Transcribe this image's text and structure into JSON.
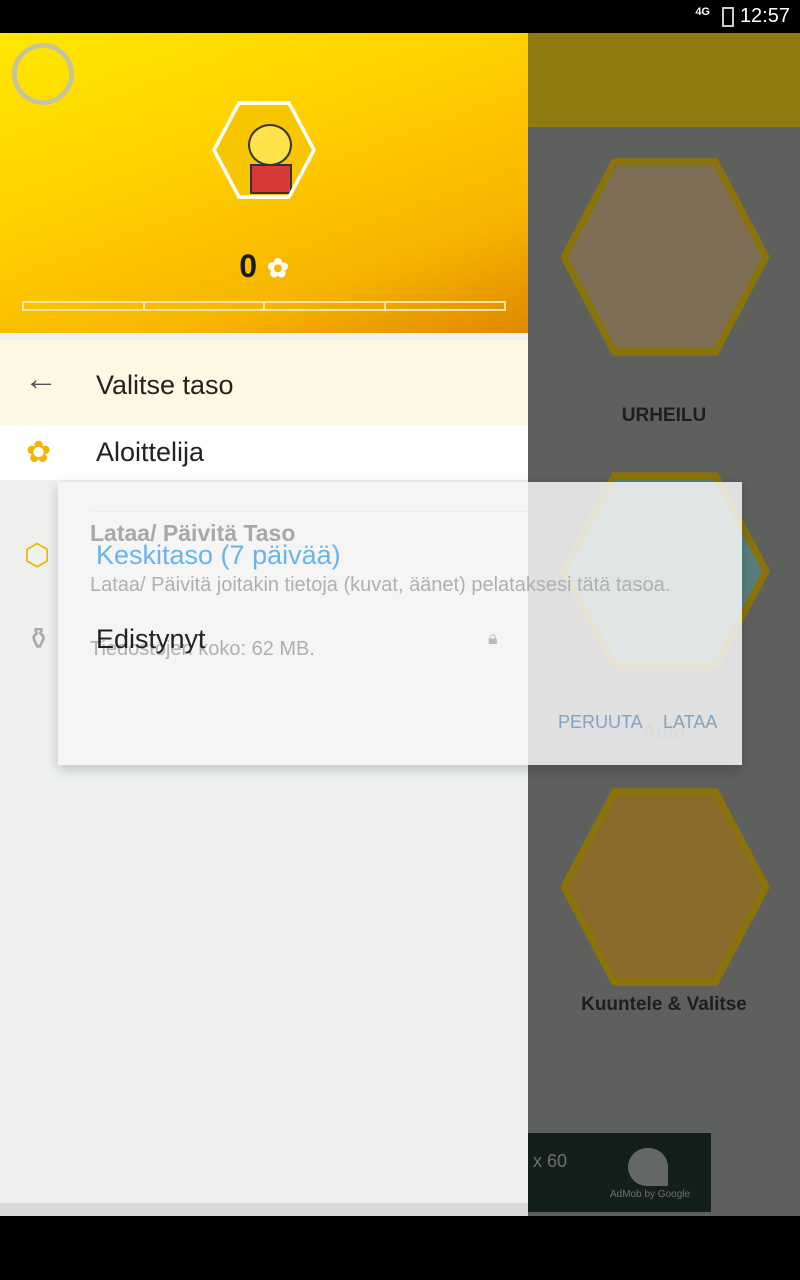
{
  "status_bar": {
    "network": "4G",
    "time": "12:57"
  },
  "background_app": {
    "tiles": [
      {
        "label": "URHEILU",
        "icon": "volleyball-icon"
      },
      {
        "label": "Auto",
        "icon": "car-icon"
      },
      {
        "label": "Kuuntele & Valitse",
        "icon": "categories-icon"
      }
    ],
    "ad": {
      "size_text": "x 60",
      "brand": "AdMob by Google"
    }
  },
  "drawer": {
    "score": "0",
    "progress_segments": 4,
    "progress_fraction": 0,
    "menu_title": "Valitse taso",
    "levels": [
      {
        "label": "Aloittelija",
        "icon": "flower-icon",
        "color": "#f5b400"
      },
      {
        "label": "Keskitaso (7 päivää)",
        "icon": "hexagon-icon",
        "color": "#6ab4ec"
      },
      {
        "label": "Edistynyt",
        "icon": "jar-icon",
        "locked": true
      }
    ]
  },
  "dialog": {
    "title": "Lataa/ Päivitä Taso",
    "message": "Lataa/ Päivitä joitakin tietoja (kuvat, äänet) pelataksesi tätä tasoa.",
    "size": "Tiedostojen koko: 62 MB.",
    "cancel": "PERUUTA",
    "confirm": "LATAA"
  }
}
